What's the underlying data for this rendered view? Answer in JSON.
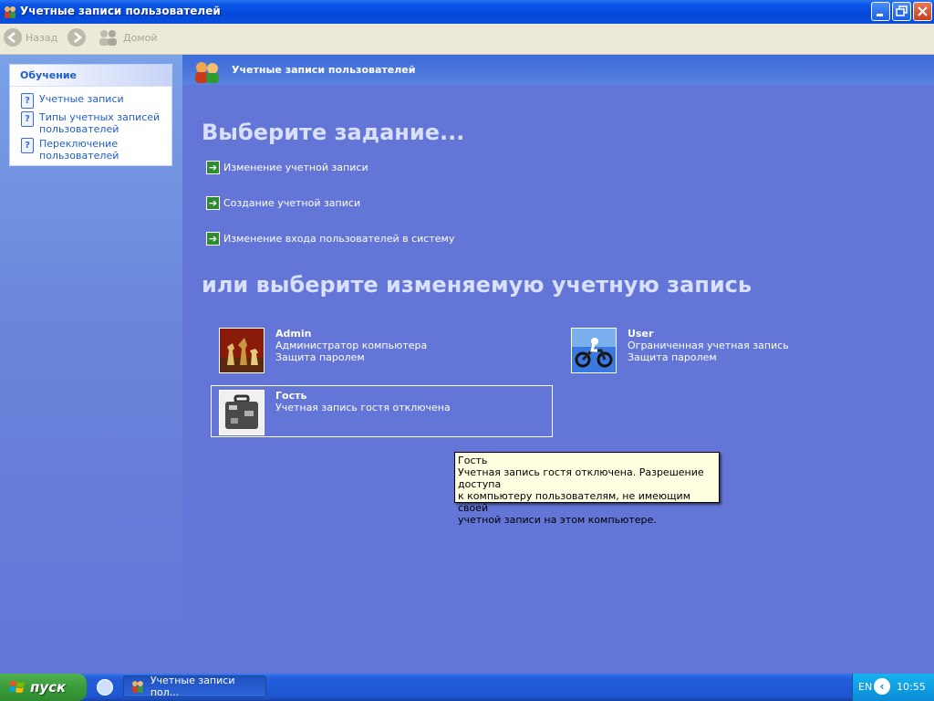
{
  "window": {
    "title": "Учетные записи пользователей"
  },
  "toolbar": {
    "back_label": "Назад",
    "home_label": "Домой"
  },
  "sidebar": {
    "title": "Обучение",
    "items": [
      {
        "label_line1": "Учетные записи",
        "label_line2": ""
      },
      {
        "label_line1": "Типы учетных записей",
        "label_line2": "пользователей"
      },
      {
        "label_line1": "Переключение",
        "label_line2": "пользователей"
      }
    ]
  },
  "main": {
    "header_title": "Учетные записи пользователей",
    "pick_task_heading": "Выберите задание...",
    "tasks": [
      {
        "label": "Изменение учетной записи"
      },
      {
        "label": "Создание учетной записи"
      },
      {
        "label": "Изменение входа пользователей в систему"
      }
    ],
    "pick_account_heading": "или выберите изменяемую учетную запись",
    "accounts": [
      {
        "name": "Admin",
        "type": "Администратор компьютера",
        "status": "Защита паролем"
      },
      {
        "name": "User",
        "type": "Ограниченная учетная запись",
        "status": "Защита паролем"
      },
      {
        "name": "Гость",
        "type": "Учетная запись гостя отключена",
        "status": ""
      }
    ]
  },
  "tooltip": {
    "title": "Гость",
    "line1": "Учетная запись гостя отключена. Разрешение доступа",
    "line2": "к компьютеру пользователям, не имеющим своей",
    "line3": "учетной записи на этом компьютере."
  },
  "taskbar": {
    "start_label": "пуск",
    "task_item_label": "Учетные записи пол...",
    "language": "EN",
    "clock": "10:55"
  },
  "icons": {
    "help": "?",
    "arrow": "➔",
    "tray_chevron": "‹"
  }
}
